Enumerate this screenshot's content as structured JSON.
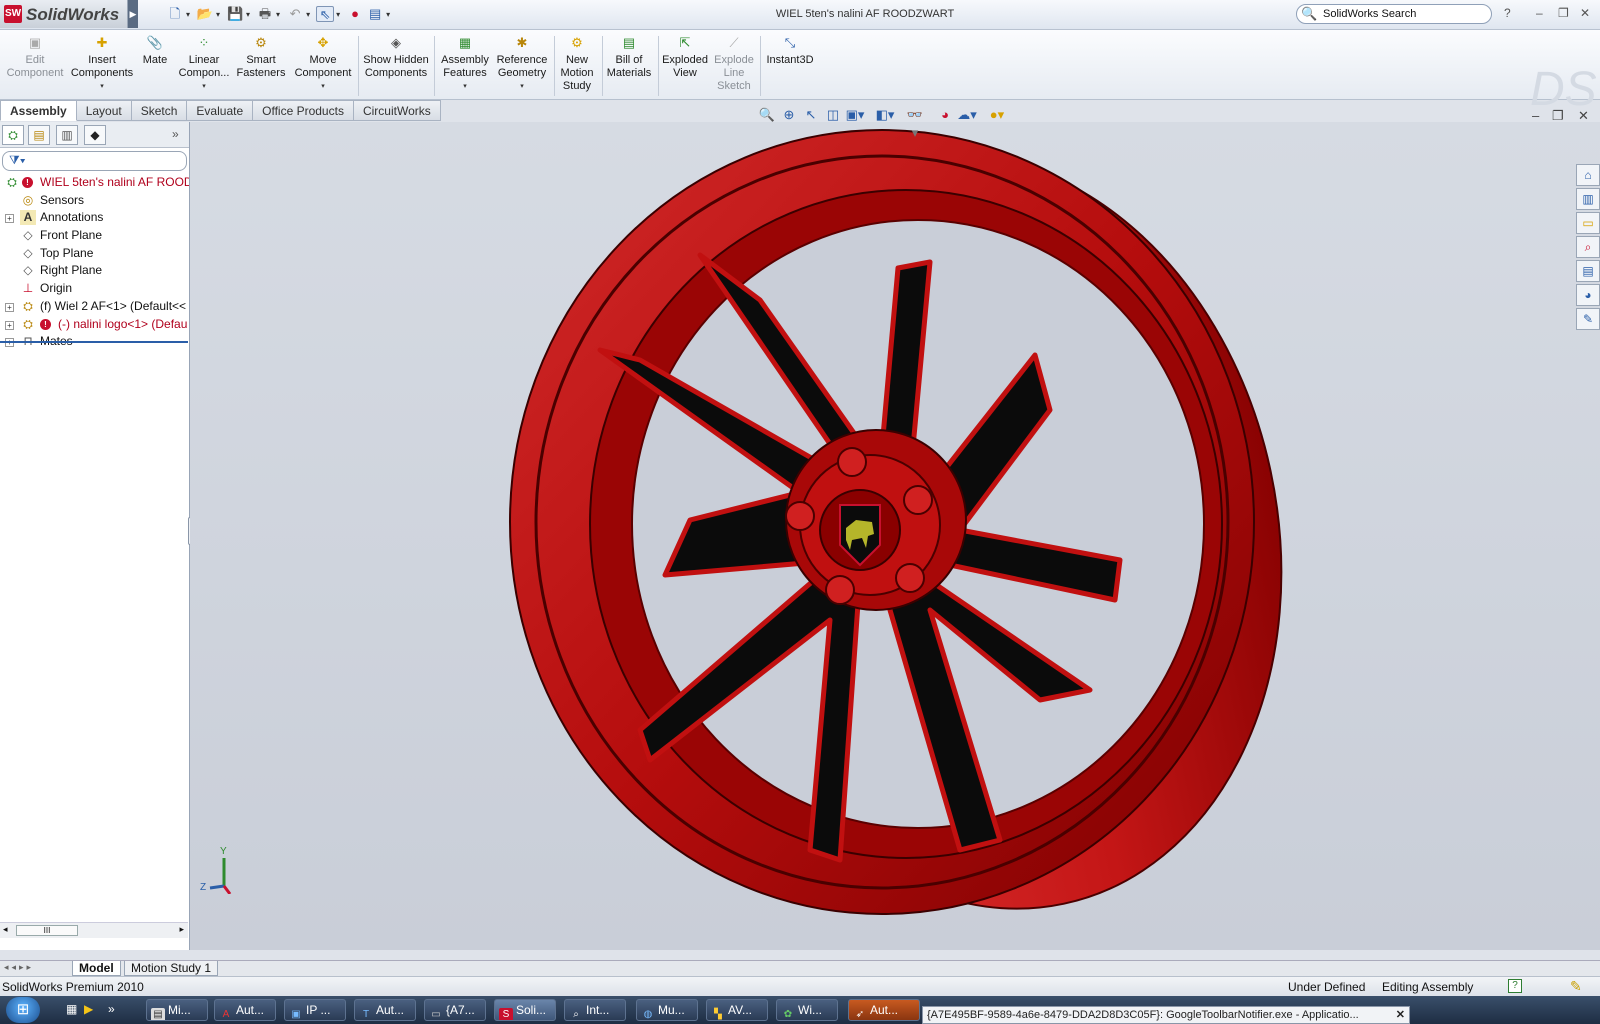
{
  "app": {
    "name": "SolidWorks",
    "logo_badge": "SW"
  },
  "window": {
    "title": "WIEL 5ten's nalini AF ROODZWART"
  },
  "search": {
    "placeholder": "SolidWorks Search"
  },
  "title_controls": {
    "help": "?",
    "minimize": "–",
    "restore": "❐",
    "close": "✕"
  },
  "commands": {
    "edit_component": "Edit Component",
    "insert_components": "Insert Components",
    "mate": "Mate",
    "linear_component": "Linear Compon...",
    "smart_fasteners": "Smart Fasteners",
    "move_component": "Move Component",
    "show_hidden": "Show Hidden Components",
    "assembly_features": "Assembly Features",
    "reference_geometry": "Reference Geometry",
    "new_motion_study": "New Motion Study",
    "bill_of_materials": "Bill of Materials",
    "exploded_view": "Exploded View",
    "explode_line_sketch": "Explode Line Sketch",
    "instant3d": "Instant3D"
  },
  "tabs": [
    "Assembly",
    "Layout",
    "Sketch",
    "Evaluate",
    "Office Products",
    "CircuitWorks"
  ],
  "tree": {
    "root": "WIEL 5ten's nalini AF ROODZ",
    "sensors": "Sensors",
    "annotations": "Annotations",
    "front_plane": "Front Plane",
    "top_plane": "Top Plane",
    "right_plane": "Right Plane",
    "origin": "Origin",
    "wiel": "(f) Wiel 2 AF<1> (Default<<",
    "logo": "(-) nalini logo<1> (Defau",
    "mates": "Mates"
  },
  "scroll_thumb": "III",
  "triad": {
    "y": "Y",
    "z": "Z"
  },
  "bottom_tabs": {
    "model": "Model",
    "motion": "Motion Study 1"
  },
  "status": {
    "product": "SolidWorks Premium 2010",
    "state": "Under Defined",
    "mode": "Editing Assembly"
  },
  "taskbar": {
    "items": [
      "Mi...",
      "Aut...",
      "IP ...",
      "Aut...",
      "{A7...",
      "Soli...",
      "Int...",
      "Mu...",
      "AV...",
      "Wi...",
      "Aut..."
    ]
  },
  "notification": "{A7E495BF-9589-4a6e-8479-DDA2D8D3C05F}: GoogleToolbarNotifier.exe - Applicatio...",
  "colors": {
    "wheel_red": "#b50d0d",
    "spoke_black": "#0b0b0b",
    "accent_red": "#c8102e"
  }
}
